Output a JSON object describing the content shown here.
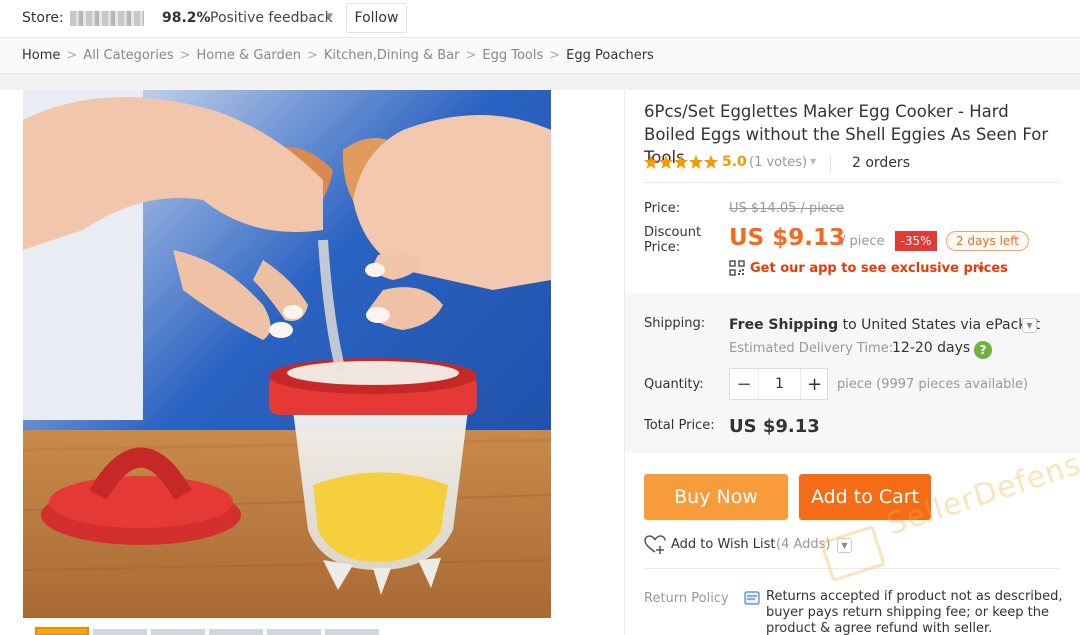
{
  "store": {
    "label": "Store:",
    "positive_pct": "98.2%",
    "feedback_label": "Positive feedback",
    "follow_label": "Follow"
  },
  "breadcrumb": {
    "items": [
      "Home",
      "All Categories",
      "Home & Garden",
      "Kitchen,Dining & Bar",
      "Egg Tools",
      "Egg Poachers"
    ],
    "separator": ">"
  },
  "product": {
    "title": "6Pcs/Set Egglettes Maker Egg Cooker - Hard Boiled Eggs without the Shell Eggies As Seen For Tools",
    "rating": "5.0",
    "votes": "(1 votes)",
    "stars": 5,
    "orders": "2 orders"
  },
  "price": {
    "price_label": "Price:",
    "original": "US $14.05 / piece",
    "discount_label": "Discount Price:",
    "current": "US $9.13",
    "per_unit": "/ piece",
    "discount_badge": "-35%",
    "days_left": "2 days left",
    "app_promo": "Get our app to see exclusive prices"
  },
  "shipping": {
    "label": "Shipping:",
    "free": "Free Shipping",
    "to": "to",
    "country": "United States",
    "via": "via",
    "method": "ePacket",
    "est_label": "Estimated Delivery Time:",
    "est_value": "12-20 days"
  },
  "quantity": {
    "label": "Quantity:",
    "minus": "−",
    "value": "1",
    "plus": "+",
    "available": "piece (9997 pieces available)"
  },
  "total": {
    "label": "Total Price:",
    "value": "US $9.13"
  },
  "actions": {
    "buy_now": "Buy Now",
    "add_to_cart": "Add to Cart",
    "wishlist": "Add to Wish List",
    "wishlist_count": "(4 Adds)"
  },
  "return_policy": {
    "label": "Return Policy",
    "text": "Returns accepted if product not as described, buyer pays return shipping fee; or keep the product & agree refund with seller."
  },
  "watermark": "SellerDefense",
  "colors": {
    "accent_orange": "#f36b21",
    "buy_now": "#f89b3a",
    "add_to_cart": "#f46c15",
    "discount_red": "#e53935",
    "star": "#f59b00"
  }
}
